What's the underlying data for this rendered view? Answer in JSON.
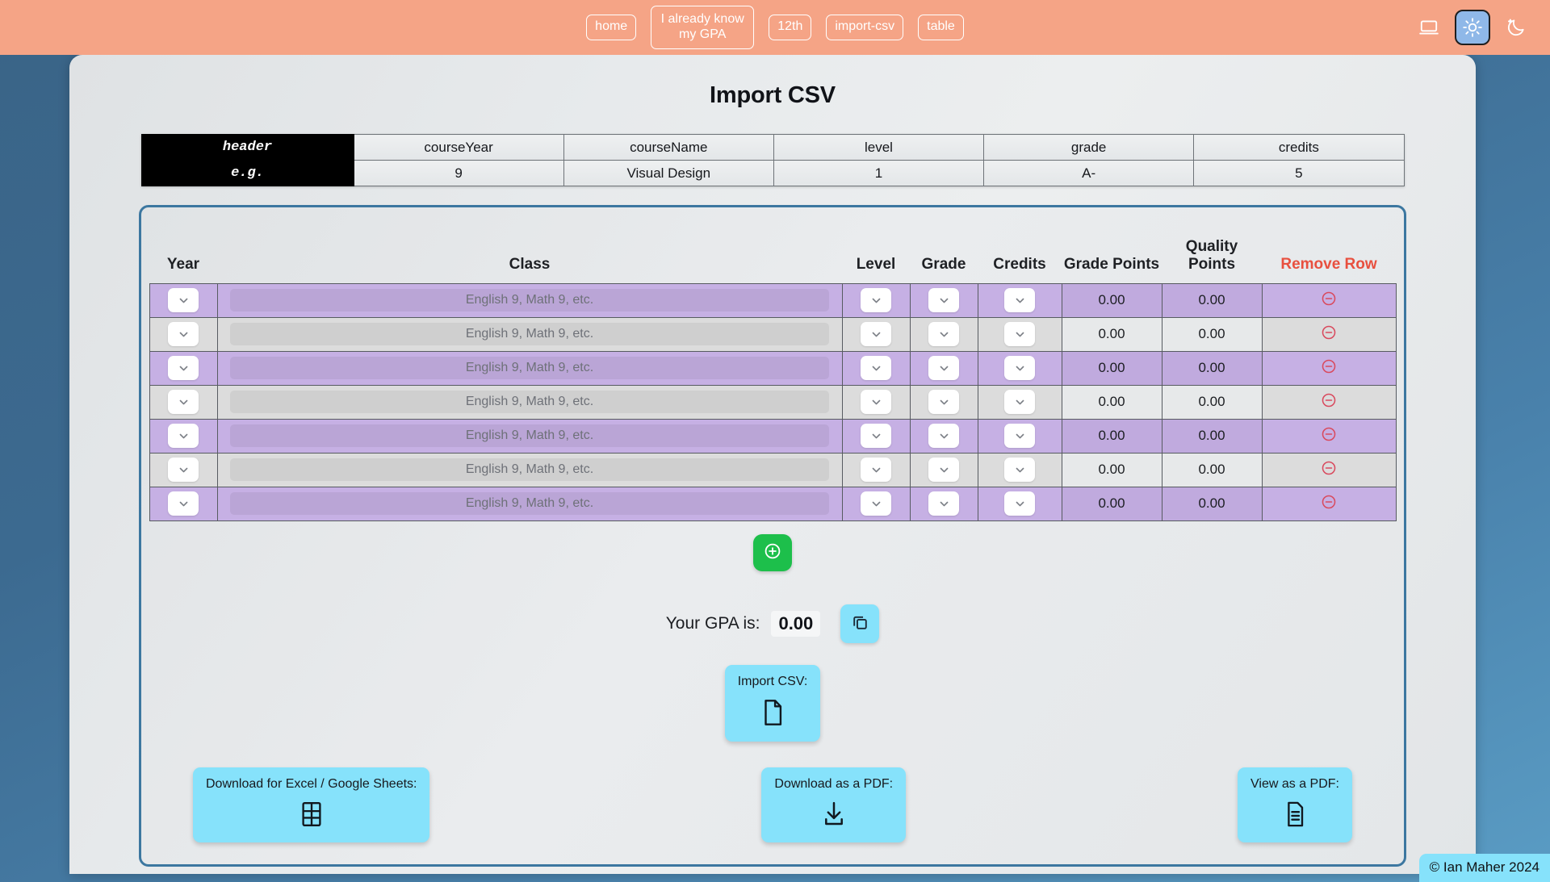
{
  "nav": {
    "items": [
      {
        "label": "home",
        "name": "nav-home"
      },
      {
        "label": "I already know my GPA",
        "name": "nav-already-know-gpa"
      },
      {
        "label": "12th",
        "name": "nav-12th"
      },
      {
        "label": "import-csv",
        "name": "nav-import-csv"
      },
      {
        "label": "table",
        "name": "nav-table"
      }
    ],
    "themes": [
      {
        "icon": "laptop-icon",
        "name": "theme-system",
        "active": false
      },
      {
        "icon": "sun-icon",
        "name": "theme-light",
        "active": true
      },
      {
        "icon": "moon-icon",
        "name": "theme-dark",
        "active": false
      }
    ],
    "background_color": "#f5a486"
  },
  "page": {
    "title": "Import CSV"
  },
  "example_table": {
    "row_labels": [
      "header",
      "e.g."
    ],
    "header_row": [
      "courseYear",
      "courseName",
      "level",
      "grade",
      "credits"
    ],
    "example_row": [
      "9",
      "Visual Design",
      "1",
      "A-",
      "5"
    ]
  },
  "grades_table": {
    "columns": [
      {
        "label": "Year",
        "name": "col-year"
      },
      {
        "label": "Class",
        "name": "col-class"
      },
      {
        "label": "Level",
        "name": "col-level"
      },
      {
        "label": "Grade",
        "name": "col-grade"
      },
      {
        "label": "Credits",
        "name": "col-credits"
      },
      {
        "label": "Grade Points",
        "name": "col-grade-points"
      },
      {
        "label": "Quality Points",
        "name": "col-quality-points"
      },
      {
        "label": "Remove Row",
        "name": "col-remove-row"
      }
    ],
    "remove_row_color": "#e8503f",
    "class_placeholder": "English 9, Math 9, etc.",
    "rows": [
      {
        "year": "",
        "class": "",
        "level": "",
        "grade": "",
        "credits": "",
        "grade_points": "0.00",
        "quality_points": "0.00"
      },
      {
        "year": "",
        "class": "",
        "level": "",
        "grade": "",
        "credits": "",
        "grade_points": "0.00",
        "quality_points": "0.00"
      },
      {
        "year": "",
        "class": "",
        "level": "",
        "grade": "",
        "credits": "",
        "grade_points": "0.00",
        "quality_points": "0.00"
      },
      {
        "year": "",
        "class": "",
        "level": "",
        "grade": "",
        "credits": "",
        "grade_points": "0.00",
        "quality_points": "0.00"
      },
      {
        "year": "",
        "class": "",
        "level": "",
        "grade": "",
        "credits": "",
        "grade_points": "0.00",
        "quality_points": "0.00"
      },
      {
        "year": "",
        "class": "",
        "level": "",
        "grade": "",
        "credits": "",
        "grade_points": "0.00",
        "quality_points": "0.00"
      },
      {
        "year": "",
        "class": "",
        "level": "",
        "grade": "",
        "credits": "",
        "grade_points": "0.00",
        "quality_points": "0.00"
      }
    ],
    "row_colors": {
      "odd": "#c6b0e4",
      "even": "#dcdcdc"
    }
  },
  "add_row": {
    "icon": "plus-circle-icon",
    "color": "#1dbf4b"
  },
  "gpa": {
    "label": "Your GPA is:",
    "value": "0.00",
    "copy_icon": "copy-icon"
  },
  "actions": {
    "import_csv": {
      "label": "Import CSV:",
      "icon": "file-icon"
    },
    "download_excel": {
      "label": "Download for Excel / Google Sheets:",
      "icon": "table-grid-icon"
    },
    "download_pdf": {
      "label": "Download as a PDF:",
      "icon": "download-icon"
    },
    "view_pdf": {
      "label": "View as a PDF:",
      "icon": "document-lines-icon"
    },
    "button_color": "#86e2fb"
  },
  "footer": {
    "copyright": "© Ian Maher 2024"
  }
}
